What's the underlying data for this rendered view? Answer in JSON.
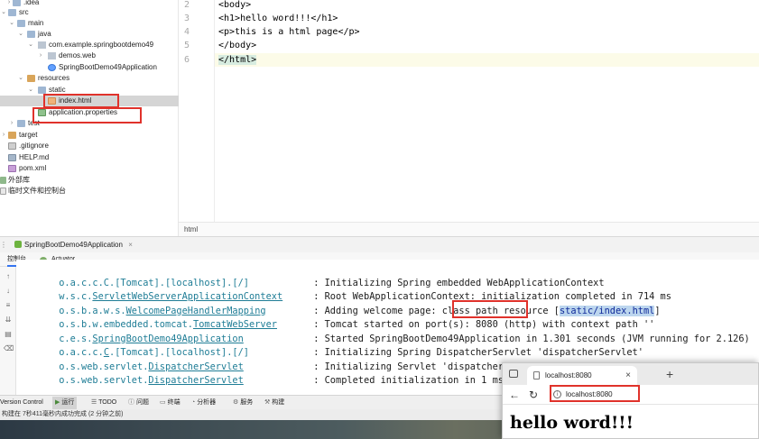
{
  "project_tree": {
    "items": [
      {
        "label": ".idea"
      },
      {
        "label": "src"
      },
      {
        "label": "main"
      },
      {
        "label": "java"
      },
      {
        "label": "com.example.springbootdemo49"
      },
      {
        "label": "demos.web"
      },
      {
        "label": "SpringBootDemo49Application"
      },
      {
        "label": "resources"
      },
      {
        "label": "static"
      },
      {
        "label": "index.html"
      },
      {
        "label": "application.properties"
      },
      {
        "label": "test"
      },
      {
        "label": "target"
      },
      {
        "label": ".gitignore"
      },
      {
        "label": "HELP.md"
      },
      {
        "label": "pom.xml"
      },
      {
        "label": "外部库"
      },
      {
        "label": "临时文件和控制台"
      }
    ]
  },
  "editor": {
    "lines": [
      {
        "num": "2",
        "code": "<body>"
      },
      {
        "num": "3",
        "code": "<h1>hello word!!!</h1>"
      },
      {
        "num": "4",
        "code": "<p>this is a html page</p>"
      },
      {
        "num": "5",
        "code": "</body>"
      },
      {
        "num": "6",
        "code": "</html>"
      }
    ],
    "breadcrumb": "html"
  },
  "run_panel": {
    "config_tab": "SpringBootDemo49Application",
    "subtabs": [
      "控制台",
      "Actuator"
    ],
    "log_lines": [
      {
        "logger": "o.a.c.c.C.[Tomcat].[localhost].[/]",
        "message": ": Initializing Spring embedded WebApplicationContext"
      },
      {
        "logger": "w.s.c.ServletWebServerApplicationContext",
        "message": ": Root WebApplicationContext: initialization completed in 714 ms"
      },
      {
        "logger": "o.s.b.a.w.s.WelcomePageHandlerMapping",
        "message_prefix": ": Adding welcome page: class path resource [",
        "highlight": "static/index.html",
        "message_suffix": "]"
      },
      {
        "logger": "o.s.b.w.embedded.tomcat.TomcatWebServer",
        "message_prefix": ": Tomcat started on port(s): ",
        "highlight": "8080 (http)",
        "message_suffix": " with context path ''"
      },
      {
        "logger": "c.e.s.SpringBootDemo49Application",
        "message": ": Started SpringBootDemo49Application in 1.301 seconds (JVM running for 2.126)"
      },
      {
        "logger": "o.a.c.c.C.[Tomcat].[localhost].[/]",
        "message": ": Initializing Spring DispatcherServlet 'dispatcherServlet'"
      },
      {
        "logger": "o.s.web.servlet.DispatcherServlet",
        "message": ": Initializing Servlet 'dispatcherServlet'"
      },
      {
        "logger": "o.s.web.servlet.DispatcherServlet",
        "message": ": Completed initialization in 1 ms"
      }
    ]
  },
  "tool_tabs": [
    "Version Control",
    "运行",
    "TODO",
    "问题",
    "终端",
    "分析器",
    "服务",
    "构建"
  ],
  "status_bar": "构建在 7秒411毫秒内成功完成 (2 分钟之前)",
  "browser": {
    "tab_title": "localhost:8080",
    "address": "localhost:8080",
    "heading": "hello word!!!"
  },
  "colors": {
    "annotation_red": "#e0322b",
    "logger_teal": "#1f7d96",
    "selection_blue": "#bcd6ee"
  }
}
